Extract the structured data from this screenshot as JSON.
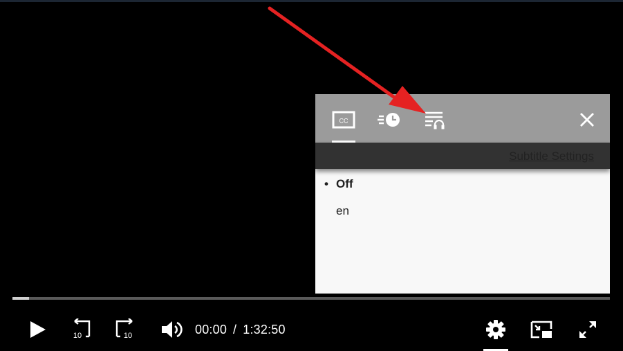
{
  "panel": {
    "tabs": [
      {
        "id": "subtitles",
        "icon": "closed-captions-icon",
        "label": "CC",
        "active": true
      },
      {
        "id": "playback-speed",
        "icon": "playback-speed-icon",
        "active": false
      },
      {
        "id": "audio-tracks",
        "icon": "audio-track-icon",
        "active": false
      }
    ],
    "close_icon": "close-icon",
    "subtitle_settings_link": "Subtitle Settings",
    "options": [
      {
        "label": "Off",
        "selected": true
      },
      {
        "label": "en",
        "selected": false
      }
    ],
    "bullet": "•"
  },
  "annotation": {
    "color": "#e52222",
    "points_to": "audio-tracks tab"
  },
  "player": {
    "progress_fraction": 0.028,
    "current_time": "00:00",
    "separator": "/",
    "duration": "1:32:50",
    "rewind_seconds": "10",
    "forward_seconds": "10",
    "icons": [
      "play-icon",
      "rewind-10-icon",
      "forward-10-icon",
      "volume-icon",
      "settings-gear-icon",
      "picture-in-picture-icon",
      "fullscreen-icon"
    ]
  }
}
